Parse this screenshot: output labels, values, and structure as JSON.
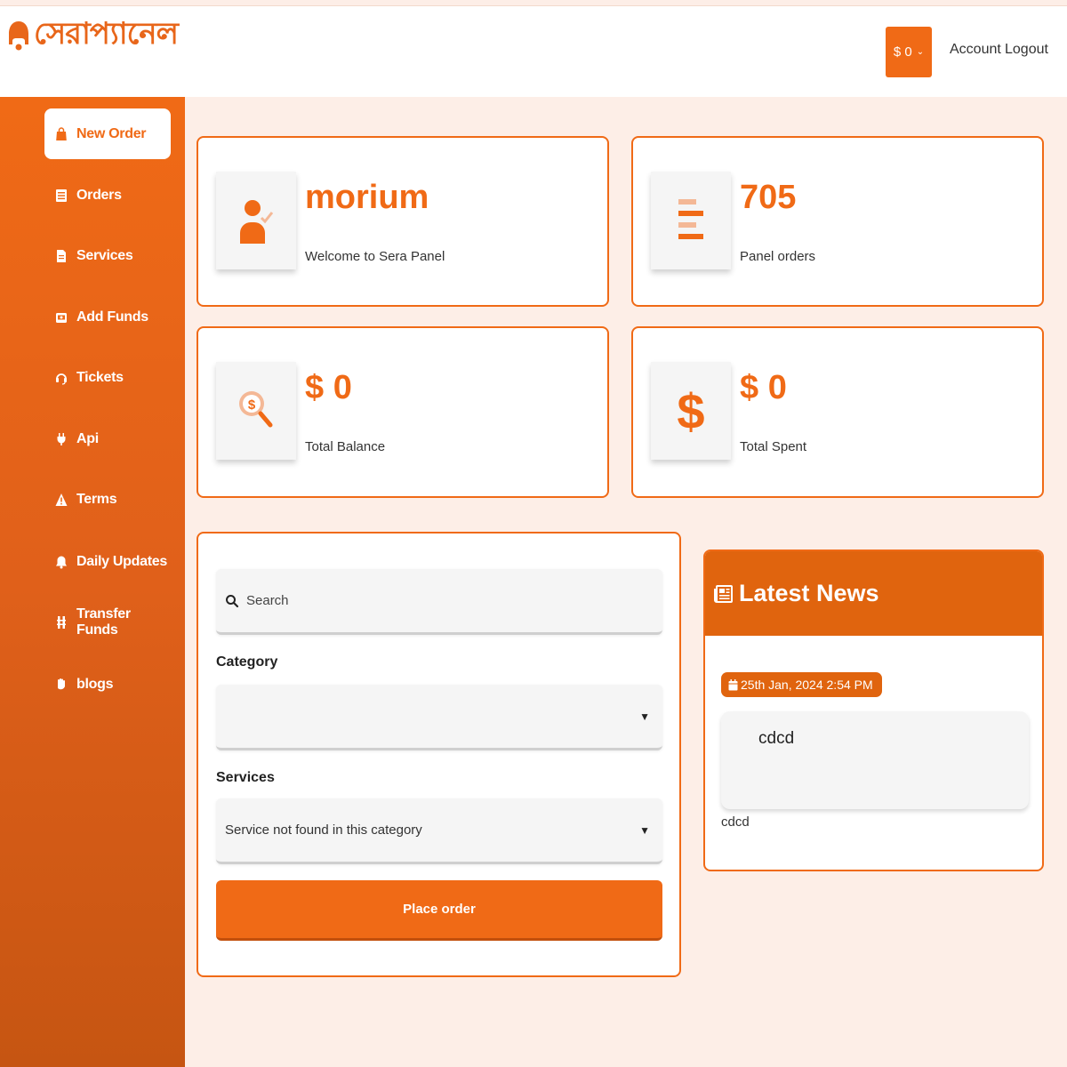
{
  "header": {
    "logo_text": "সেরাপ্যানেল",
    "balance": "$ 0",
    "account_label": "Account",
    "logout_label": "Logout"
  },
  "sidebar": {
    "items": [
      {
        "label": "New Order",
        "icon": "bag-icon",
        "active": true
      },
      {
        "label": "Orders",
        "icon": "list-icon"
      },
      {
        "label": "Services",
        "icon": "file-icon"
      },
      {
        "label": "Add Funds",
        "icon": "wallet-icon"
      },
      {
        "label": "Tickets",
        "icon": "headset-icon"
      },
      {
        "label": "Api",
        "icon": "plug-icon"
      },
      {
        "label": "Terms",
        "icon": "warning-icon"
      },
      {
        "label": "Daily Updates",
        "icon": "bell-icon"
      },
      {
        "label": "Transfer Funds",
        "icon": "transfer-icon"
      },
      {
        "label": "blogs",
        "icon": "hand-icon"
      }
    ]
  },
  "stats": {
    "user": {
      "value": "morium",
      "label": "Welcome to Sera Panel",
      "icon": "user-check-icon"
    },
    "orders": {
      "value": "705",
      "label": "Panel orders",
      "icon": "bars-icon"
    },
    "balance": {
      "value": "$ 0",
      "label": "Total Balance",
      "icon": "search-dollar-icon"
    },
    "spent": {
      "value": "$ 0",
      "label": "Total Spent",
      "icon": "dollar-icon"
    }
  },
  "order_form": {
    "search_placeholder": "Search",
    "category_label": "Category",
    "category_value": "",
    "services_label": "Services",
    "services_value": "Service not found in this category",
    "place_order_label": "Place order"
  },
  "news": {
    "title": "Latest News",
    "date": "25th Jan, 2024 2:54 PM",
    "item_title": "cdcd",
    "item_body": "cdcd"
  },
  "colors": {
    "accent": "#f06a16",
    "background": "#fdeee7"
  }
}
